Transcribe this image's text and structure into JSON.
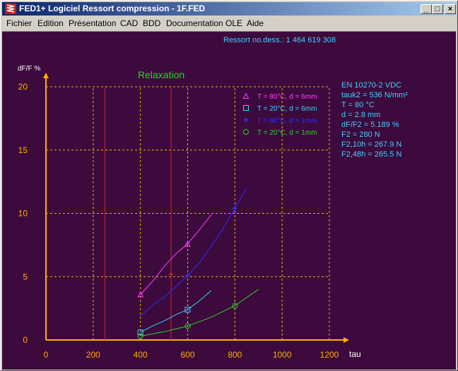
{
  "window": {
    "title": "FED1+  Logiciel Ressort compression  - 1F.FED",
    "buttons": [
      "_",
      "□",
      "×"
    ]
  },
  "menu": [
    "Fichier",
    "Edition",
    "Présentation",
    "CAD",
    "BDD",
    "Documentation",
    "OLE",
    "Aide"
  ],
  "header": "Ressort  no.dess.: 1 464 619 308",
  "info": [
    "EN 10270-2 VDC",
    "tauk2 = 536 N/mm²",
    "T = 80 °C",
    "d = 2.8 mm",
    "dF/F2 = 5.189 %",
    "F2 = 280 N",
    "F2,10h = 267.9 N",
    "F2,48h = 265.5 N"
  ],
  "colors": {
    "bg": "#3c0a3c",
    "axis": "#ffb000",
    "grid": "#e0c000",
    "cursor": "#e02010",
    "text": "#40d0ff"
  },
  "chart_data": {
    "type": "line",
    "title": "Relaxation",
    "xlabel": "tau",
    "ylabel": "dF/F %",
    "xlim": [
      0,
      1200
    ],
    "ylim": [
      0,
      20
    ],
    "xticks": [
      0,
      200,
      400,
      600,
      800,
      1000,
      1200
    ],
    "yticks": [
      0,
      5,
      10,
      15,
      20
    ],
    "grid": true,
    "legend_position": "top-right",
    "vertical_lines": [
      250,
      530
    ],
    "cursor_point": {
      "x": 530,
      "y": 5.19
    },
    "series": [
      {
        "name": "T = 80°C,  d = 6mm",
        "color": "#ff40ff",
        "marker": "triangle",
        "x": [
          400,
          450,
          500,
          550,
          600,
          650,
          700
        ],
        "y": [
          3.6,
          4.6,
          5.8,
          6.8,
          7.6,
          8.7,
          9.9
        ],
        "marker_x": [
          400,
          600
        ],
        "marker_y": [
          3.6,
          7.6
        ]
      },
      {
        "name": "T = 20°C,  d = 6mm",
        "color": "#40d0ff",
        "marker": "square",
        "x": [
          400,
          450,
          500,
          550,
          600,
          650,
          700
        ],
        "y": [
          0.6,
          1.1,
          1.5,
          2.0,
          2.4,
          3.1,
          3.9
        ],
        "marker_x": [
          400,
          600
        ],
        "marker_y": [
          0.6,
          2.4
        ]
      },
      {
        "name": "T = 80°C,  d = 1mm",
        "color": "#3030ff",
        "marker": "cross",
        "x": [
          400,
          450,
          500,
          550,
          600,
          650,
          700,
          750,
          800,
          850
        ],
        "y": [
          1.9,
          2.7,
          3.4,
          4.2,
          5.1,
          6.1,
          7.4,
          8.8,
          10.4,
          12.0
        ],
        "marker_x": [
          600,
          800
        ],
        "marker_y": [
          5.1,
          10.4
        ]
      },
      {
        "name": "T = 20°C,  d = 1mm",
        "color": "#30d030",
        "marker": "circle",
        "x": [
          400,
          500,
          600,
          700,
          800,
          900
        ],
        "y": [
          0.3,
          0.65,
          1.1,
          1.8,
          2.7,
          4.0
        ],
        "marker_x": [
          400,
          600,
          800
        ],
        "marker_y": [
          0.3,
          1.1,
          2.7
        ]
      }
    ]
  }
}
